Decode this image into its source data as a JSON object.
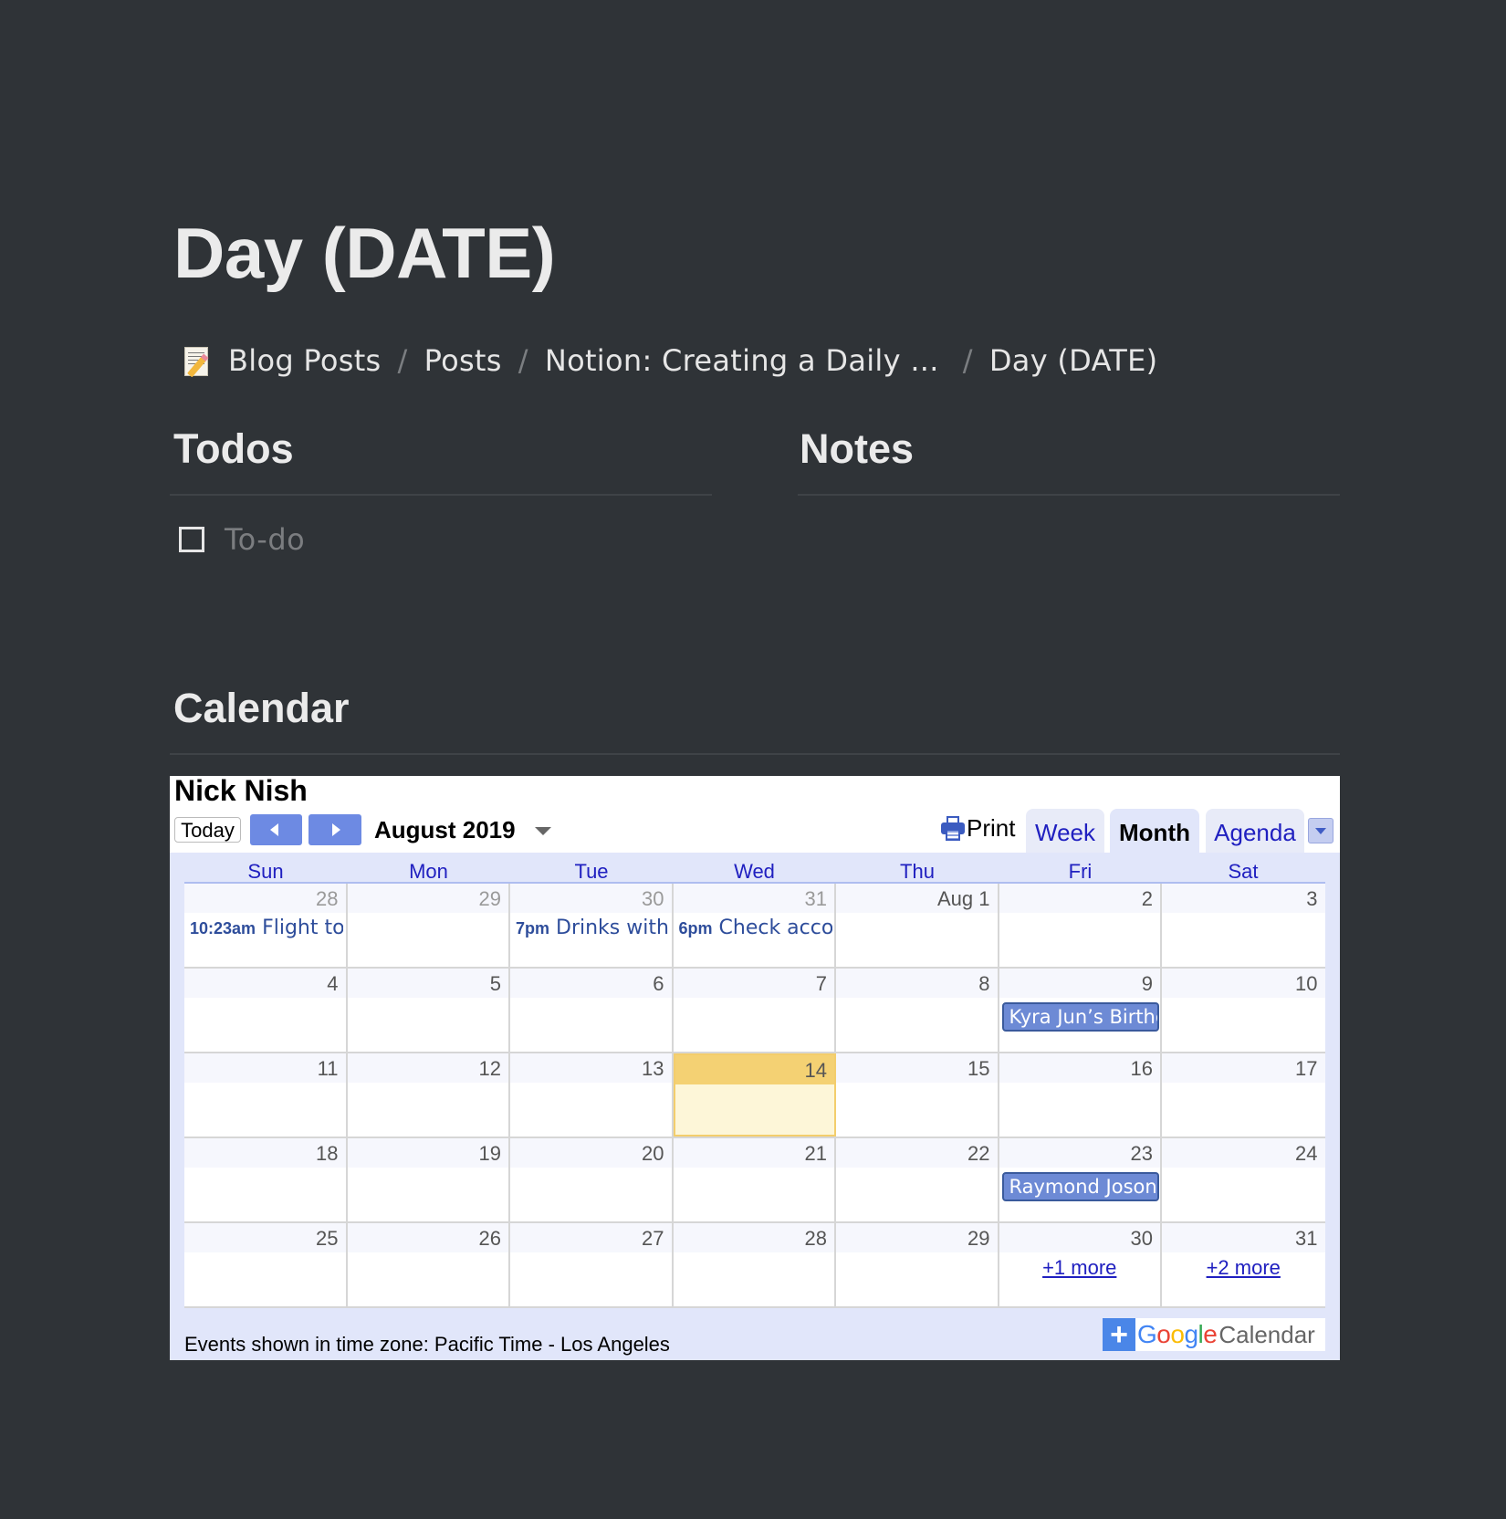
{
  "page": {
    "title": "Day (DATE)",
    "breadcrumb": [
      {
        "label": "Blog Posts",
        "icon": "memo-icon"
      },
      {
        "label": "Posts"
      },
      {
        "label": "Notion: Creating a Daily ..."
      },
      {
        "label": "Day (DATE)"
      }
    ],
    "breadcrumb_separator": "/"
  },
  "todos": {
    "heading": "Todos",
    "items": [
      {
        "label": "To-do",
        "checked": false,
        "placeholder": true
      }
    ]
  },
  "notes": {
    "heading": "Notes"
  },
  "calendar_section": {
    "heading": "Calendar"
  },
  "gcal": {
    "owner": "Nick Nish",
    "today_label": "Today",
    "month_label": "August 2019",
    "print_label": "Print",
    "views": [
      {
        "label": "Week",
        "active": false
      },
      {
        "label": "Month",
        "active": true
      },
      {
        "label": "Agenda",
        "active": false
      }
    ],
    "weekdays": [
      "Sun",
      "Mon",
      "Tue",
      "Wed",
      "Thu",
      "Fri",
      "Sat"
    ],
    "weeks": [
      [
        {
          "day": "28",
          "other": true,
          "event": {
            "time": "10:23am",
            "title": "Flight to"
          }
        },
        {
          "day": "29",
          "other": true
        },
        {
          "day": "30",
          "other": true,
          "event": {
            "time": "7pm",
            "title": "Drinks with"
          }
        },
        {
          "day": "31",
          "other": true,
          "event": {
            "time": "6pm",
            "title": "Check acco"
          }
        },
        {
          "day": "Aug 1"
        },
        {
          "day": "2"
        },
        {
          "day": "3"
        }
      ],
      [
        {
          "day": "4"
        },
        {
          "day": "5"
        },
        {
          "day": "6"
        },
        {
          "day": "7"
        },
        {
          "day": "8"
        },
        {
          "day": "9",
          "chip": "Kyra Jun’s Birthday"
        },
        {
          "day": "10"
        }
      ],
      [
        {
          "day": "11"
        },
        {
          "day": "12"
        },
        {
          "day": "13"
        },
        {
          "day": "14",
          "today": true
        },
        {
          "day": "15"
        },
        {
          "day": "16"
        },
        {
          "day": "17"
        }
      ],
      [
        {
          "day": "18"
        },
        {
          "day": "19"
        },
        {
          "day": "20"
        },
        {
          "day": "21"
        },
        {
          "day": "22"
        },
        {
          "day": "23",
          "chip": "Raymond Joson"
        },
        {
          "day": "24"
        }
      ],
      [
        {
          "day": "25"
        },
        {
          "day": "26"
        },
        {
          "day": "27"
        },
        {
          "day": "28"
        },
        {
          "day": "29"
        },
        {
          "day": "30",
          "more": "+1 more"
        },
        {
          "day": "31",
          "more": "+2 more"
        }
      ]
    ],
    "timezone_note": "Events shown in time zone: Pacific Time - Los Angeles",
    "badge": {
      "plus": "+",
      "google": "Google",
      "calendar": "Calendar"
    },
    "colors": {
      "nav_button": "#6d8ae3",
      "today_highlight": "#f4d173",
      "event_chip": "#6d8ad5",
      "link": "#2020c0"
    }
  }
}
